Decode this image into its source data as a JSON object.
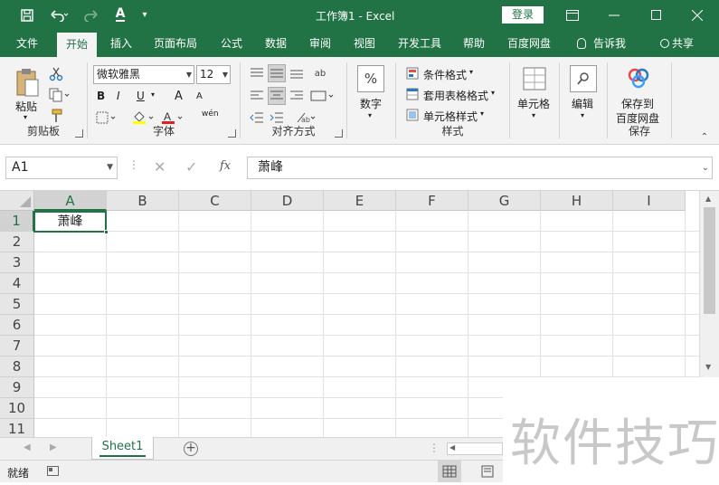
{
  "titlebar": {
    "save_icon": "save-icon",
    "undo_icon": "undo-icon",
    "redo_icon": "redo-icon",
    "font_color_icon": "font-color-icon",
    "title": "工作簿1  -  Excel",
    "login": "登录",
    "brand_color": "#217346"
  },
  "tabs": [
    "文件",
    "开始",
    "插入",
    "页面布局",
    "公式",
    "数据",
    "审阅",
    "视图",
    "开发工具",
    "帮助",
    "百度网盘",
    "告诉我",
    "共享"
  ],
  "ribbon": {
    "clipboard": {
      "label": "剪贴板",
      "paste": "粘贴"
    },
    "font": {
      "label": "字体",
      "font_name": "微软雅黑",
      "font_size": "12",
      "bold": "B",
      "italic": "I",
      "underline": "U",
      "grow": "A",
      "shrink": "A",
      "color_a": "A",
      "phonetic": "wén"
    },
    "alignment": {
      "label": "对齐方式"
    },
    "number": {
      "label": "数字",
      "symbol": "%"
    },
    "styles": {
      "label": "样式",
      "conditional": "条件格式",
      "table": "套用表格格式",
      "cell_styles": "单元格样式"
    },
    "cells": {
      "label": "单元格"
    },
    "editing": {
      "label": "编辑"
    },
    "save": {
      "label": "保存",
      "save_to": "保存到",
      "baidu": "百度网盘"
    }
  },
  "formula_bar": {
    "name_box": "A1",
    "fx": "fx",
    "content": "萧峰"
  },
  "grid": {
    "columns": [
      "A",
      "B",
      "C",
      "D",
      "E",
      "F",
      "G",
      "H",
      "I"
    ],
    "rows": [
      "1",
      "2",
      "3",
      "4",
      "5",
      "6",
      "7",
      "8",
      "9",
      "10",
      "11"
    ],
    "a1_value": "萧峰"
  },
  "sheet_tabs": {
    "active": "Sheet1"
  },
  "status": {
    "ready": "就绪"
  },
  "watermark": "软件技巧"
}
